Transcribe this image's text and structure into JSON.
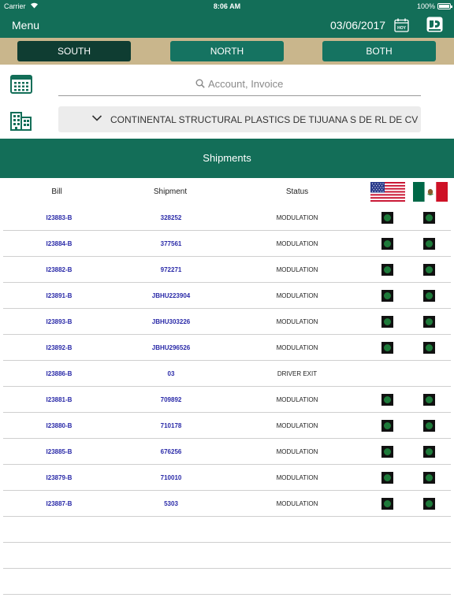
{
  "status_bar": {
    "carrier": "Carrier",
    "time": "8:06 AM",
    "battery": "100%"
  },
  "navbar": {
    "menu_label": "Menu",
    "date": "03/06/2017",
    "hoy_label": "HOY"
  },
  "segments": [
    {
      "label": "SOUTH",
      "active": true
    },
    {
      "label": "NORTH",
      "active": false
    },
    {
      "label": "BOTH",
      "active": false
    }
  ],
  "search": {
    "placeholder": "Account, Invoice",
    "value": ""
  },
  "client_select": {
    "value": "CONTINENTAL STRUCTURAL PLASTICS DE TIJUANA S DE RL DE CV"
  },
  "section_title": "Shipments",
  "table": {
    "headers": {
      "bill": "Bill",
      "shipment": "Shipment",
      "status": "Status"
    },
    "rows": [
      {
        "bill": "I23883-B",
        "shipment": "328252",
        "status": "MODULATION",
        "us": true,
        "mx": true
      },
      {
        "bill": "I23884-B",
        "shipment": "377561",
        "status": "MODULATION",
        "us": true,
        "mx": true
      },
      {
        "bill": "I23882-B",
        "shipment": "972271",
        "status": "MODULATION",
        "us": true,
        "mx": true
      },
      {
        "bill": "I23891-B",
        "shipment": "JBHU223904",
        "status": "MODULATION",
        "us": true,
        "mx": true
      },
      {
        "bill": "I23893-B",
        "shipment": "JBHU303226",
        "status": "MODULATION",
        "us": true,
        "mx": true
      },
      {
        "bill": "I23892-B",
        "shipment": "JBHU296526",
        "status": "MODULATION",
        "us": true,
        "mx": true
      },
      {
        "bill": "I23886-B",
        "shipment": "03",
        "status": "DRIVER EXIT",
        "us": false,
        "mx": false
      },
      {
        "bill": "I23881-B",
        "shipment": "709892",
        "status": "MODULATION",
        "us": true,
        "mx": true
      },
      {
        "bill": "I23880-B",
        "shipment": "710178",
        "status": "MODULATION",
        "us": true,
        "mx": true
      },
      {
        "bill": "I23885-B",
        "shipment": "676256",
        "status": "MODULATION",
        "us": true,
        "mx": true
      },
      {
        "bill": "I23879-B",
        "shipment": "710010",
        "status": "MODULATION",
        "us": true,
        "mx": true
      },
      {
        "bill": "I23887-B",
        "shipment": "5303",
        "status": "MODULATION",
        "us": true,
        "mx": true
      }
    ]
  },
  "icons": {
    "calendar": "calendar-icon",
    "building": "building-icon",
    "search": "search-icon",
    "chevron": "chevron-down-icon",
    "hoy": "calendar-today-icon",
    "logo": "app-logo-icon",
    "us_flag": "us-flag-icon",
    "mx_flag": "mexico-flag-icon"
  },
  "colors": {
    "primary": "#136e58",
    "segment_bar": "#c9b68c",
    "segment_active": "#0f3d32",
    "link": "#2a2aa8",
    "indicator": "#1e7a3a"
  }
}
